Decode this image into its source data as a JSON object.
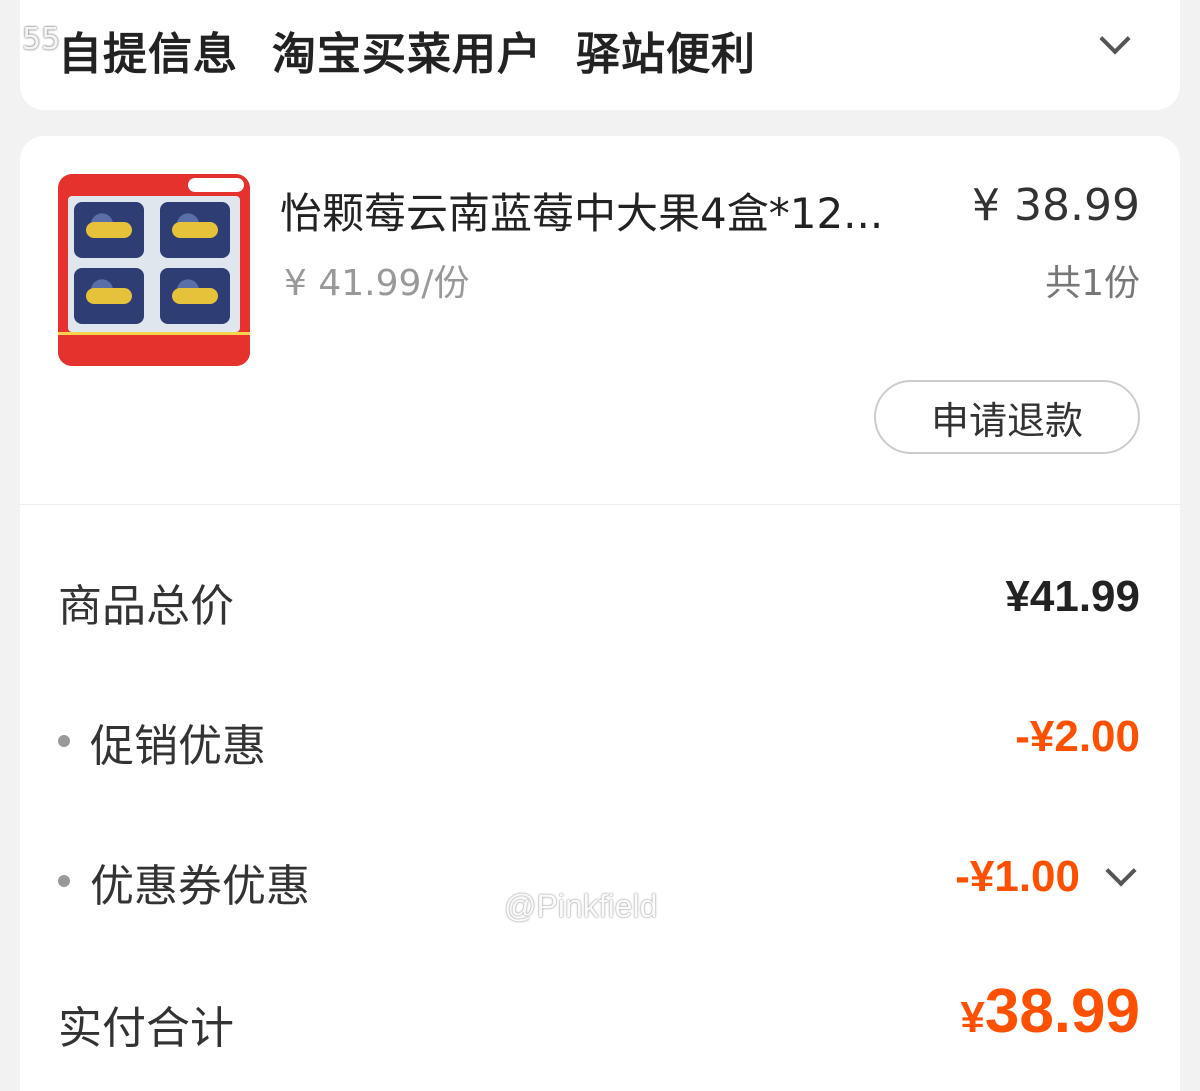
{
  "pickup": {
    "words": [
      "自提信息",
      "淘宝买菜用户",
      "驿站便利"
    ]
  },
  "watermark": {
    "top": "55",
    "bottom": "@Pinkfield"
  },
  "product": {
    "name": "怡颗莓云南蓝莓中大果4盒*12...",
    "unit_price": "¥ 41.99/份",
    "price": "¥ 38.99",
    "quantity": "共1份",
    "refund_label": "申请退款"
  },
  "summary": {
    "goods_total_label": "商品总价",
    "goods_total_value": "¥41.99",
    "promo_label": "促销优惠",
    "promo_value": "-¥2.00",
    "coupon_label": "优惠券优惠",
    "coupon_value": "-¥1.00",
    "paid_label": "实付合计",
    "paid_currency": "¥",
    "paid_amount": "38.99"
  },
  "colors": {
    "accent": "#ff5000",
    "background": "#f2f2f2"
  }
}
